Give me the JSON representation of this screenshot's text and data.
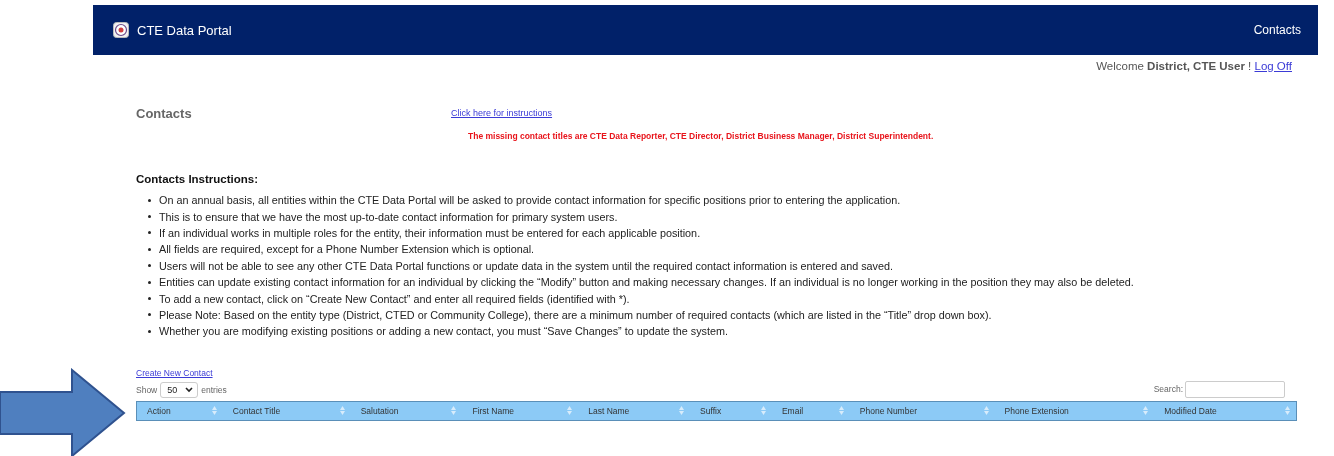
{
  "navbar": {
    "brand": "CTE Data Portal",
    "links": [
      {
        "label": "Contacts",
        "selected": true
      }
    ]
  },
  "user_bar": {
    "greeting": "Welcome",
    "user": "District, CTE User",
    "suffix": "!",
    "logoff": "Log Off"
  },
  "page": {
    "title": "Contacts",
    "instructions_link": "Click here for instructions",
    "alert": "The missing contact titles are CTE Data Reporter, CTE Director, District Business Manager, District Superintendent."
  },
  "instructions": {
    "heading": "Contacts Instructions:",
    "items": [
      "On an annual basis, all entities within the CTE Data Portal will be asked to provide contact information for specific positions prior to entering the application.",
      "This is to ensure that we have the most up-to-date contact information for primary system users.",
      "If an individual works in multiple roles for the entity, their information must be entered for each applicable position.",
      "All fields are required, except for a Phone Number Extension which is optional.",
      "Users will not be able to see any other CTE Data Portal functions or update data in the system until the required contact information is entered and saved.",
      "Entities can update existing contact information for an individual by clicking the “Modify” button and making necessary changes.  If an individual is no longer working in the position they may also be deleted.",
      "To add a new contact, click on “Create New Contact” and enter all required fields (identified with *).",
      "Please Note:  Based on the entity type (District, CTED or Community College), there are a minimum number of required contacts (which are listed in the “Title” drop down box).",
      "Whether you are modifying existing positions or adding a new contact, you must “Save Changes” to update the system."
    ]
  },
  "create_link": "Create New Contact",
  "table_controls": {
    "show_label": "Show",
    "page_size": "50",
    "entries_label": "entries",
    "search_label": "Search:"
  },
  "table": {
    "columns": [
      "Action",
      "Contact Title",
      "Salutation",
      "First Name",
      "Last Name",
      "Suffix",
      "Email",
      "Phone Number",
      "Phone Extension",
      "Modified Date"
    ]
  }
}
